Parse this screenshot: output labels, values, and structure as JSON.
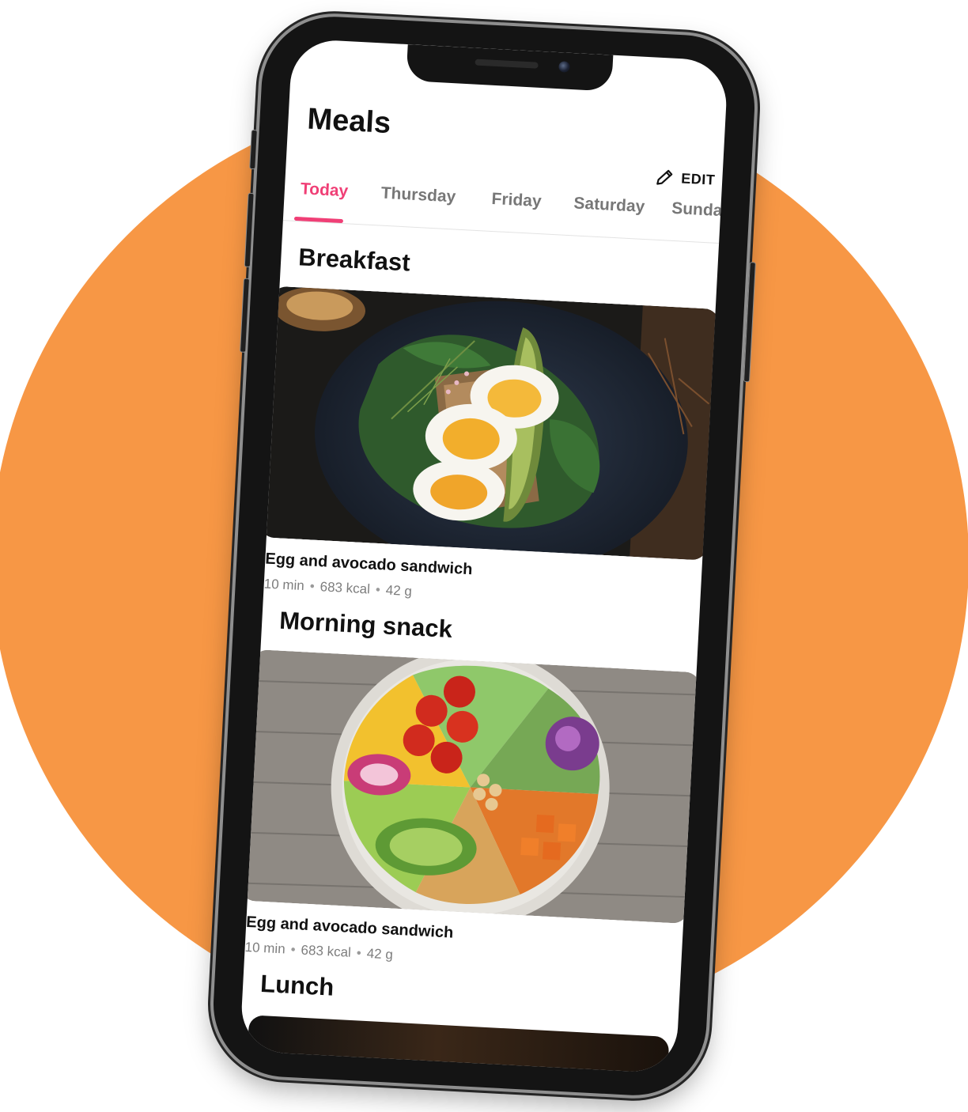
{
  "colors": {
    "accent": "#f03f76",
    "background_blob": "#f79745",
    "phone_frame": "#141414"
  },
  "header": {
    "title": "Meals",
    "edit_label": "EDIT",
    "edit_icon": "pencil-icon"
  },
  "tabs": [
    {
      "label": "Today",
      "active": true
    },
    {
      "label": "Thursday",
      "active": false
    },
    {
      "label": "Friday",
      "active": false
    },
    {
      "label": "Saturday",
      "active": false
    },
    {
      "label": "Sunday",
      "active": false
    }
  ],
  "sections": [
    {
      "title": "Breakfast",
      "card": {
        "image": "egg-avocado-toast-photo",
        "title": "Egg and avocado sandwich",
        "time": "10 min",
        "calories": "683 kcal",
        "weight": "42 g"
      }
    },
    {
      "title": "Morning snack",
      "card": {
        "image": "vegetable-bowl-photo",
        "title": "Egg and avocado sandwich",
        "time": "10 min",
        "calories": "683 kcal",
        "weight": "42 g"
      }
    },
    {
      "title": "Lunch"
    }
  ]
}
